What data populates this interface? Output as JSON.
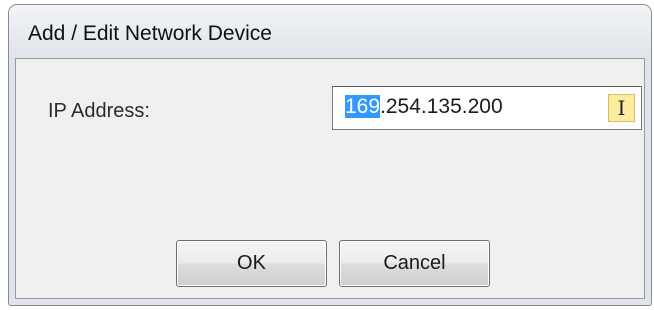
{
  "window": {
    "title": "Add / Edit Network Device"
  },
  "form": {
    "ip_label": "IP Address:",
    "ip_value": {
      "selected_part": "169",
      "rest": ".254.135.200"
    },
    "cursor_icon": "text-cursor-icon"
  },
  "buttons": {
    "ok_label": "OK",
    "cancel_label": "Cancel"
  }
}
